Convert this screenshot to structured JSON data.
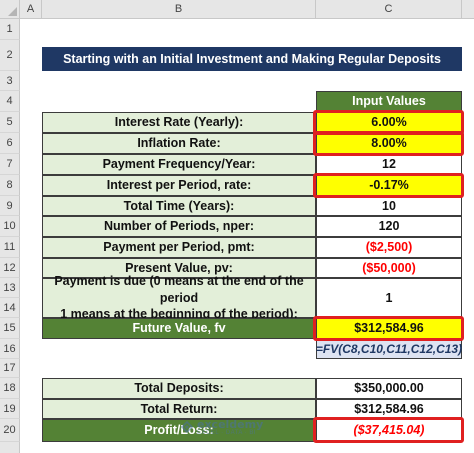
{
  "columns": [
    "A",
    "B",
    "C"
  ],
  "rows": [
    "1",
    "2",
    "3",
    "4",
    "5",
    "6",
    "7",
    "8",
    "9",
    "10",
    "11",
    "12",
    "13",
    "14",
    "15",
    "16",
    "17",
    "18",
    "19",
    "20"
  ],
  "title": "Starting with an Initial Investment and Making Regular Deposits",
  "input_header": "Input Values",
  "items": {
    "interest_rate": {
      "label": "Interest Rate (Yearly):",
      "value": "6.00%"
    },
    "inflation_rate": {
      "label": "Inflation Rate:",
      "value": "8.00%"
    },
    "payment_frequency": {
      "label": "Payment Frequency/Year:",
      "value": "12"
    },
    "interest_per_period": {
      "label": "Interest per Period, rate:",
      "value": "-0.17%"
    },
    "total_time": {
      "label": "Total Time (Years):",
      "value": "10"
    },
    "number_of_periods": {
      "label": "Number of Periods, nper:",
      "value": "120"
    },
    "payment_per_period": {
      "label": "Payment per Period, pmt:",
      "value": "($2,500)"
    },
    "present_value": {
      "label": "Present Value, pv:",
      "value": "($50,000)"
    },
    "payment_due": {
      "label_line1": "Payment is due (0 means at the end of the period",
      "label_line2": "1 means at the beginning of the period):",
      "value": "1"
    },
    "future_value": {
      "label": "Future Value, fv",
      "value": "$312,584.96"
    }
  },
  "formula": "=FV(C8,C10,C11,C12,C13)",
  "summary": {
    "total_deposits": {
      "label": "Total Deposits:",
      "value": "$350,000.00"
    },
    "total_return": {
      "label": "Total Return:",
      "value": "$312,584.96"
    },
    "profit_loss": {
      "label": "Profit/Loss:",
      "value": "($37,415.04)"
    }
  },
  "watermark": {
    "brand": "exceldemy",
    "tagline": "EXCEL · DATA · BI"
  },
  "colors": {
    "title_bg": "#1f3864",
    "green": "#548235",
    "label_bg": "#e3efd9",
    "highlight": "#ffff00",
    "outline": "#e02020",
    "negative": "#ff0000"
  }
}
